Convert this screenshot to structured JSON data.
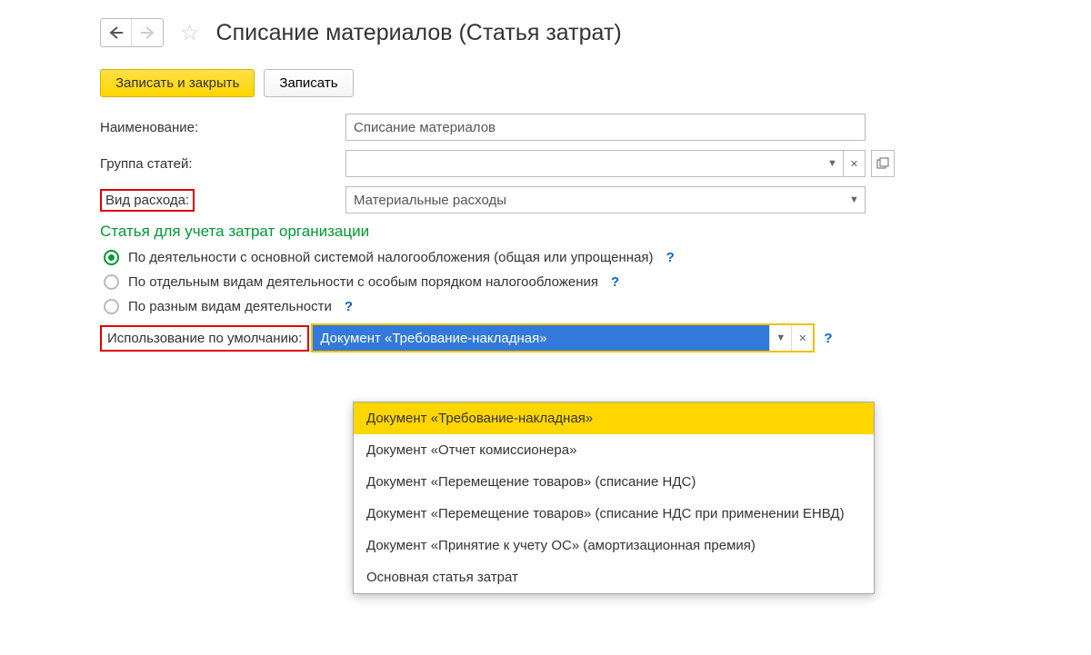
{
  "header": {
    "title": "Списание материалов (Статья затрат)"
  },
  "toolbar": {
    "save_close": "Записать и закрыть",
    "save": "Записать"
  },
  "fields": {
    "name_label": "Наименование:",
    "name_value": "Списание материалов",
    "group_label": "Группа статей:",
    "group_value": "",
    "expense_type_label": "Вид расхода:",
    "expense_type_value": "Материальные расходы"
  },
  "section": {
    "title": "Статья для учета затрат организации",
    "radio1": "По деятельности с основной системой налогообложения (общая или упрощенная)",
    "radio2": "По отдельным видам деятельности с особым порядком налогообложения",
    "radio3": "По разным видам деятельности"
  },
  "usage": {
    "label": "Использование по умолчанию:",
    "value": "Документ «Требование-накладная»"
  },
  "dropdown": {
    "items": [
      "Документ «Требование-накладная»",
      "Документ «Отчет комиссионера»",
      "Документ «Перемещение товаров» (списание НДС)",
      "Документ «Перемещение товаров» (списание НДС при применении ЕНВД)",
      "Документ «Принятие к учету ОС» (амортизационная премия)",
      "Основная статья затрат"
    ]
  }
}
